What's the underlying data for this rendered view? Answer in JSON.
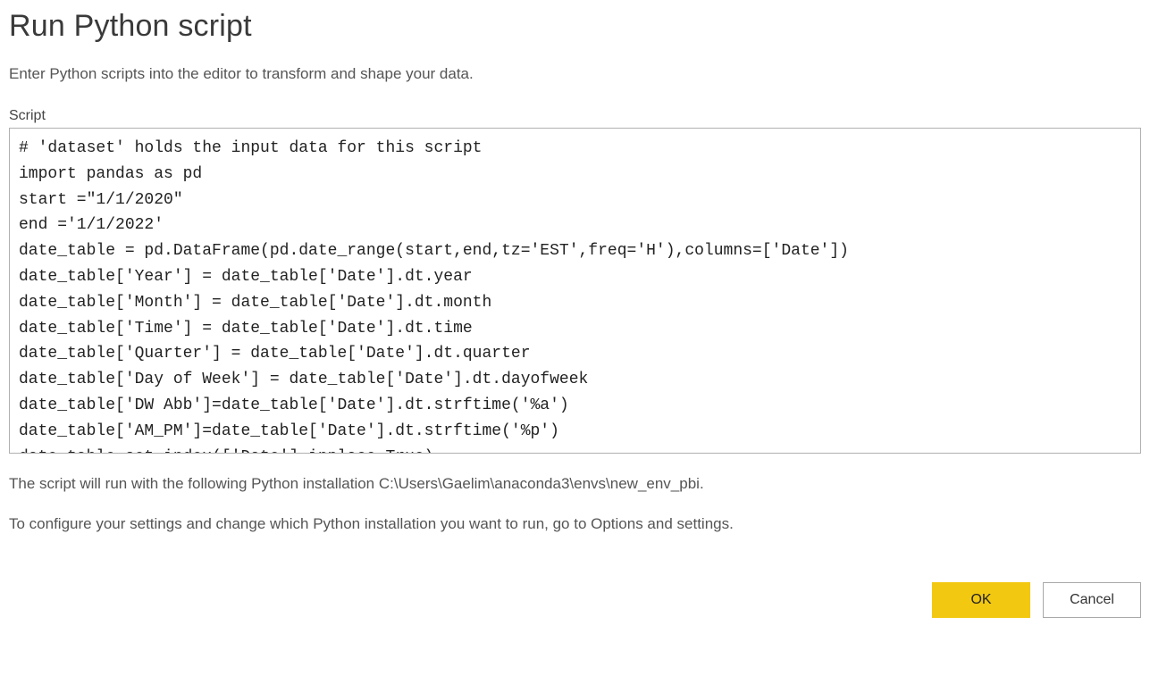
{
  "dialog": {
    "title": "Run Python script",
    "subtitle": "Enter Python scripts into the editor to transform and shape your data.",
    "script_label": "Script",
    "script_content": "# 'dataset' holds the input data for this script\nimport pandas as pd\nstart =\"1/1/2020\"\nend ='1/1/2022'\ndate_table = pd.DataFrame(pd.date_range(start,end,tz='EST',freq='H'),columns=['Date'])\ndate_table['Year'] = date_table['Date'].dt.year\ndate_table['Month'] = date_table['Date'].dt.month\ndate_table['Time'] = date_table['Date'].dt.time\ndate_table['Quarter'] = date_table['Date'].dt.quarter\ndate_table['Day of Week'] = date_table['Date'].dt.dayofweek\ndate_table['DW Abb']=date_table['Date'].dt.strftime('%a')\ndate_table['AM_PM']=date_table['Date'].dt.strftime('%p')\ndate_table.set_index(['Date'],inplace=True)",
    "install_info": "The script will run with the following Python installation C:\\Users\\Gaelim\\anaconda3\\envs\\new_env_pbi.",
    "config_hint": "To configure your settings and change which Python installation you want to run, go to Options and settings.",
    "ok_label": "OK",
    "cancel_label": "Cancel"
  },
  "colors": {
    "accent": "#f2c811"
  }
}
